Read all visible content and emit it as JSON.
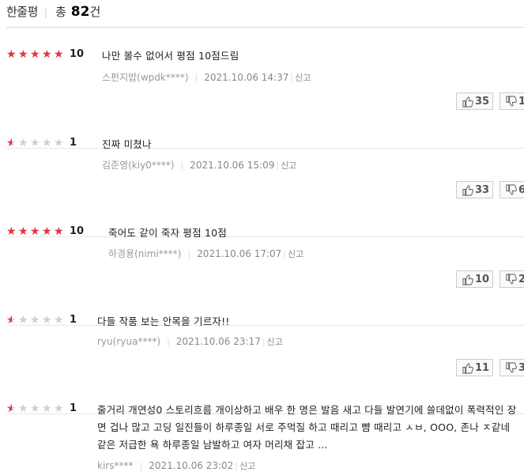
{
  "header": {
    "section_title": "한줄평",
    "total_label": "총",
    "total_count": "82",
    "total_unit": "건"
  },
  "colors": {
    "star_on": "#e8323d",
    "star_off": "#cfcfcf"
  },
  "icons": {
    "star": "★",
    "thumb_up": "thumb-up-icon",
    "thumb_down": "thumb-down-icon"
  },
  "reviews": [
    {
      "rating_stars": 5,
      "score": "10",
      "comment": "나만 볼수 없어서 평점 10점드림",
      "author": "스펀지밥(wpdk****)",
      "date": "2021.10.06 14:37",
      "report_label": "신고",
      "likes": "35",
      "dislikes": "1"
    },
    {
      "rating_stars": 0.5,
      "score": "1",
      "comment": "진짜 미쳤나",
      "author": "김준영(kiy0****)",
      "date": "2021.10.06 15:09",
      "report_label": "신고",
      "likes": "33",
      "dislikes": "6"
    },
    {
      "rating_stars": 5,
      "score": "10",
      "comment": "죽어도 같이 죽자 평점 10점",
      "author": "하경용(nimi****)",
      "date": "2021.10.06 17:07",
      "report_label": "신고",
      "likes": "10",
      "dislikes": "2"
    },
    {
      "rating_stars": 0.5,
      "score": "1",
      "comment": "다들 작품 보는 안목을 기르자!!",
      "author": "ryu(ryua****)",
      "date": "2021.10.06 23:17",
      "report_label": "신고",
      "likes": "11",
      "dislikes": "3"
    },
    {
      "rating_stars": 0.5,
      "score": "1",
      "comment": "줄거리 개연성0 스토리흐름 개이상하고 배우 한 명은 발음 새고 다들 발연기에 쓸데없이 폭력적인 장면 겁나 많고 고딩 일진들이 하루종일 서로 주먹질 하고 때리고 뺨 때리고 ㅅㅂ, OOO, 존나 ㅈ같네 같은 저급한 욕 하루종일 남발하고 여자 머리채 잡고 ...",
      "author": "kirs****",
      "date": "2021.10.06 23:02",
      "report_label": "신고",
      "likes": "",
      "dislikes": ""
    }
  ]
}
